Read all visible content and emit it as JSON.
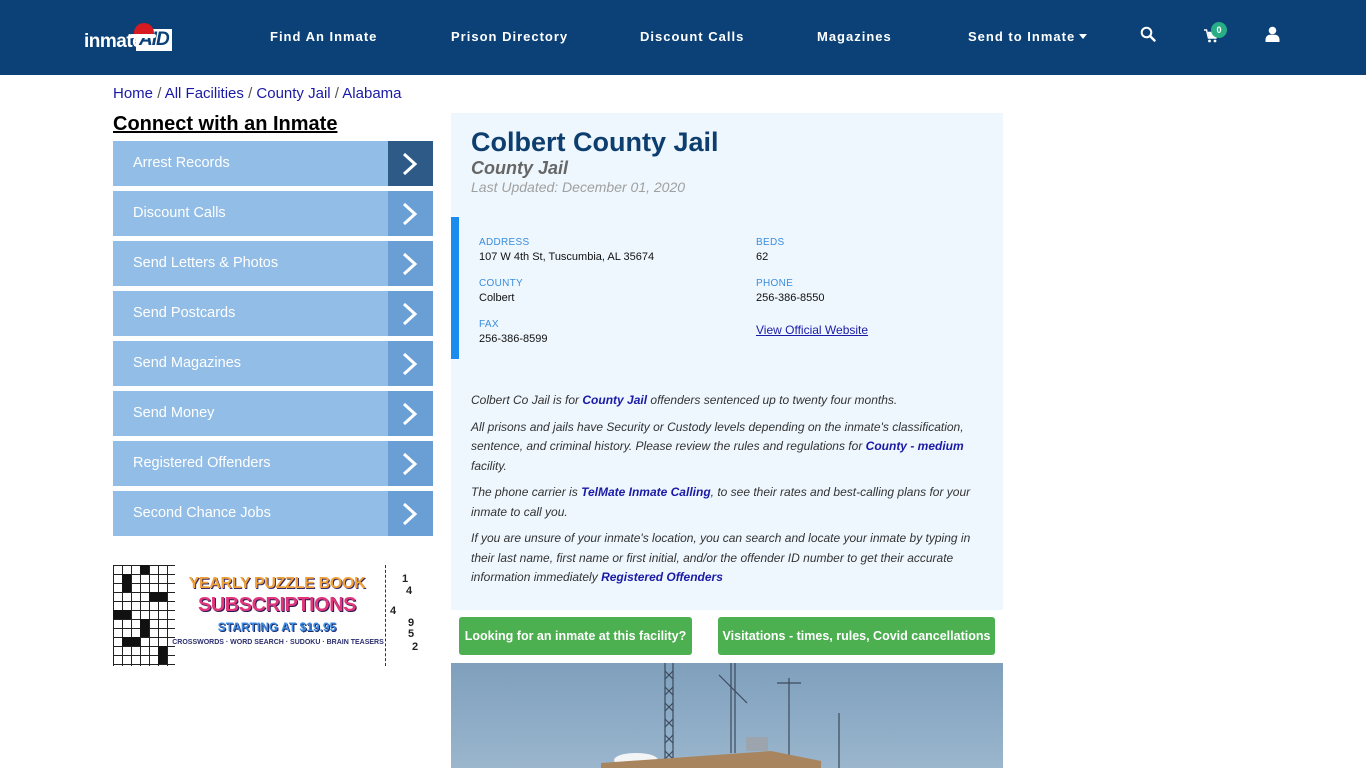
{
  "header": {
    "logo": {
      "text_main": "inmate",
      "text_accent": "AID"
    },
    "nav": [
      {
        "label": "Find An Inmate"
      },
      {
        "label": "Prison Directory"
      },
      {
        "label": "Discount Calls"
      },
      {
        "label": "Magazines"
      },
      {
        "label": "Send to Inmate",
        "has_dropdown": true
      }
    ],
    "icons": {
      "search": "search-icon",
      "cart": "cart-icon",
      "user": "user-icon"
    },
    "cart_count": "0",
    "colors": {
      "bar": "#0b4176",
      "badge": "#27ae84"
    }
  },
  "breadcrumb": {
    "items": [
      "Home",
      "All Facilities",
      "County Jail",
      "Alabama"
    ],
    "separator": "/"
  },
  "sidebar": {
    "title": "Connect with an Inmate",
    "items": [
      {
        "label": "Arrest Records"
      },
      {
        "label": "Discount Calls"
      },
      {
        "label": "Send Letters & Photos"
      },
      {
        "label": "Send Postcards"
      },
      {
        "label": "Send Magazines"
      },
      {
        "label": "Send Money"
      },
      {
        "label": "Registered Offenders"
      },
      {
        "label": "Second Chance Jobs"
      }
    ],
    "ad": {
      "line1": "YEARLY PUZZLE BOOK",
      "line2": "SUBSCRIPTIONS",
      "line3": "STARTING AT $19.95",
      "line4": "CROSSWORDS · WORD SEARCH · SUDOKU · BRAIN TEASERS",
      "sudoku_digits": [
        "1",
        "4",
        "4",
        "9",
        "5",
        "2"
      ]
    }
  },
  "facility": {
    "name": "Colbert County Jail",
    "type": "County Jail",
    "last_updated": "Last Updated: December 01, 2020",
    "fields": {
      "address": {
        "label": "ADDRESS",
        "value": "107 W 4th St, Tuscumbia, AL 35674"
      },
      "beds": {
        "label": "BEDS",
        "value": "62"
      },
      "county": {
        "label": "COUNTY",
        "value": "Colbert"
      },
      "phone": {
        "label": "PHONE",
        "value": "256-386-8550"
      },
      "fax": {
        "label": "FAX",
        "value": "256-386-8599"
      },
      "website": {
        "label": "View Official Website"
      }
    },
    "description": {
      "p1": {
        "pre": "Colbert Co Jail is for ",
        "link": "County Jail",
        "post": " offenders sentenced up to twenty four months."
      },
      "p2": {
        "pre": "All prisons and jails have Security or Custody levels depending on the inmate's classification, sentence, and criminal history. Please review the rules and regulations for ",
        "link": "County - medium",
        "post": " facility."
      },
      "p3": {
        "pre": "The phone carrier is ",
        "link": "TelMate Inmate Calling",
        "post": ", to see their rates and best-calling plans for your inmate to call you."
      },
      "p4": {
        "pre": "If you are unsure of your inmate's location, you can search and locate your inmate by typing in their last name, first name or first initial, and/or the offender ID number to get their accurate information immediately ",
        "link": "Registered Offenders",
        "post": ""
      }
    }
  },
  "actions": {
    "find_inmate": "Looking for an inmate at this facility?",
    "visitations": "Visitations - times, rules, Covid cancellations"
  }
}
